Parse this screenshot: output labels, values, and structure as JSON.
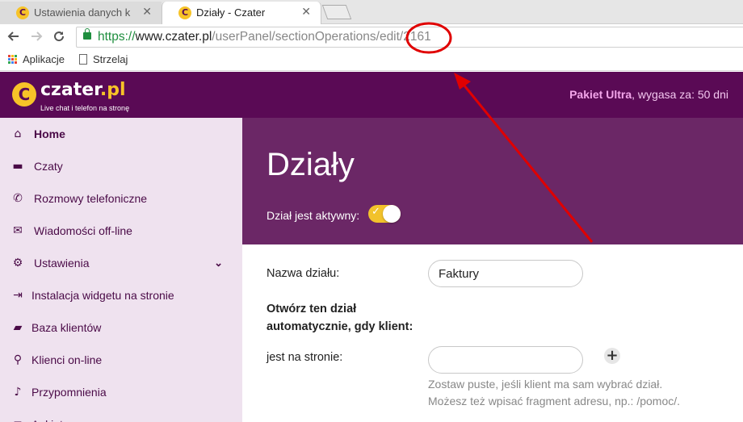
{
  "browser": {
    "tabs": [
      {
        "title": "Ustawienia danych kli",
        "close": "✕",
        "active": false
      },
      {
        "title": "Działy - Czater",
        "close": "✕",
        "active": true
      }
    ],
    "url": {
      "scheme": "https://",
      "host": "www.czater.pl",
      "path": "/userPanel/sectionOperations/edit/2161"
    },
    "bookmarks": [
      {
        "label": "Aplikacje",
        "icon": "apps-grid-icon"
      },
      {
        "label": "Strzelaj",
        "icon": "page-icon"
      }
    ],
    "apps_grid_colors": [
      "#e94235",
      "#fbbc05",
      "#34a853",
      "#4285f4",
      "#e94235",
      "#fbbc05",
      "#34a853",
      "#4285f4",
      "#e94235"
    ]
  },
  "header": {
    "logo_letter": "C",
    "logo_name": "czater",
    "logo_tld": ".pl",
    "tagline": "Live chat i telefon na stronę",
    "plan_name": "Pakiet Ultra",
    "plan_expiry": ", wygasa za: 50 dni"
  },
  "sidebar": {
    "items": [
      {
        "label": "Home",
        "icon": "home-icon",
        "glyph": "⌂",
        "active": true
      },
      {
        "label": "Czaty",
        "icon": "chat-icon",
        "glyph": "▬"
      },
      {
        "label": "Rozmowy telefoniczne",
        "icon": "phone-icon",
        "glyph": "✆"
      },
      {
        "label": "Wiadomości off-line",
        "icon": "envelope-icon",
        "glyph": "✉"
      },
      {
        "label": "Ustawienia",
        "icon": "gear-icon",
        "glyph": "⚙",
        "chevron": "⌄"
      },
      {
        "label": "Instalacja widgetu na stronie",
        "icon": "sign-in-icon",
        "glyph": "⇥"
      },
      {
        "label": "Baza klientów",
        "icon": "folder-icon",
        "glyph": "▰"
      },
      {
        "label": "Klienci on-line",
        "icon": "search-icon",
        "glyph": "⚲"
      },
      {
        "label": "Przypomnienia",
        "icon": "bell-icon",
        "glyph": "♪"
      },
      {
        "label": "Ankiety",
        "icon": "list-icon",
        "glyph": "≡"
      }
    ]
  },
  "page": {
    "title": "Działy",
    "active_label": "Dział jest aktywny:",
    "active_on": true
  },
  "form": {
    "name_label": "Nazwa działu:",
    "name_value": "Faktury",
    "auto_open_label_line1": "Otwórz ten dział",
    "auto_open_label_line2": "automatycznie, gdy klient:",
    "on_page_label": "jest na stronie:",
    "on_page_value": "",
    "hint_line1": "Zostaw puste, jeśli klient ma sam wybrać dział.",
    "hint_line2": "Możesz też wpisać fragment adresu, np.: /pomoc/."
  },
  "colors": {
    "brand_purple": "#5a0a55",
    "hero_purple": "#6b2766",
    "accent_yellow": "#f7c328",
    "sidebar_bg": "#efe2ef",
    "annotation_red": "#e00000"
  }
}
